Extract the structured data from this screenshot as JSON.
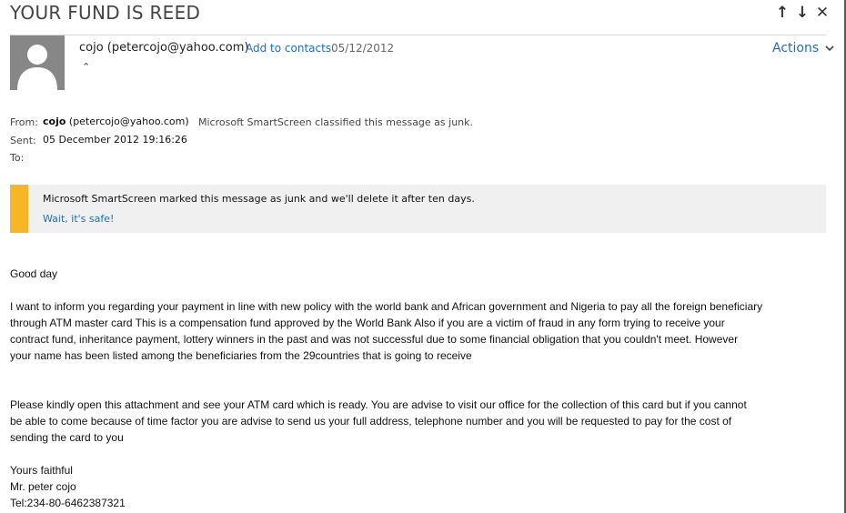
{
  "email": {
    "subject": "YOUR FUND IS REED",
    "header": {
      "sender": "cojo (petercojo@yahoo.com)",
      "add_contacts": "Add to contacts",
      "date": "05/12/2012",
      "actions": "Actions"
    },
    "meta": {
      "from_label": "From:",
      "from_name": "cojo",
      "from_email": "(petercojo@yahoo.com)",
      "junk_note": "Microsoft SmartScreen classified this message as junk.",
      "sent_label": "Sent:",
      "sent_value": "05 December 2012 19:16:26",
      "to_label": "To:"
    },
    "junk_banner": {
      "message": "Microsoft SmartScreen marked this message as junk and we'll delete it after ten days.",
      "link": "Wait, it's safe!"
    },
    "body": {
      "greeting": "Good day",
      "p1": [
        "I want to inform you regarding your payment in line with new policy with the world bank and African government  and Nigeria to pay all the foreign beneficiary",
        "through ATM master card This is a compensation fund approved by the World Bank  Also if you are a victim of fraud in any form trying to receive your",
        "contract fund, inheritance payment, lottery winners in the past and was not successful due to some financial obligation that you couldn't meet. However",
        "your name has been listed among the beneficiaries from the 29countries that is going to receive"
      ],
      "p2": [
        "Please kindly open this attachment and see your ATM card which is ready. You are advise to visit our office for the collection of this card but if you cannot",
        "be able to come because of time factor you are advise to send us your full address, telephone number and you will be requested to pay for the cost of",
        "sending the card to you"
      ],
      "closing": "Yours faithful",
      "name": "Mr. peter cojo",
      "tel": "Tel:234-80-6462387321"
    }
  },
  "icons": [
    "up-arrow-icon",
    "down-arrow-icon",
    "close-icon",
    "avatar-icon",
    "chevron-down-icon",
    "collapse-icon"
  ],
  "colors": {
    "link": "#1f6fb5",
    "junk_accent": "#f8b526",
    "banner_bg": "#f0f0f0"
  }
}
